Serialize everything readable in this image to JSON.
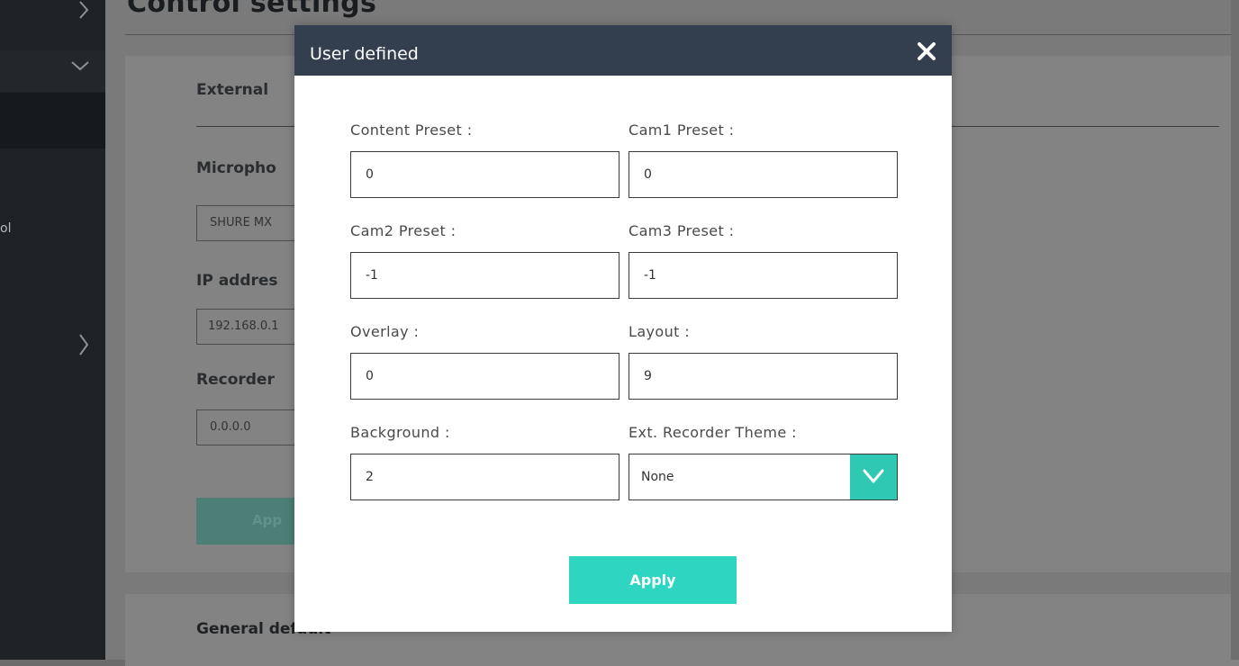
{
  "background": {
    "page_title": "Control settings",
    "sidebar_partial_text": "ol",
    "section_heading": "External",
    "microphone_label": "Micropho",
    "microphone_value": "SHURE MX",
    "ip_label": "IP addres",
    "ip_value": "192.168.0.1",
    "recorder_label": "Recorder",
    "recorder_value": "0.0.0.0",
    "apply_partial": "App",
    "general_heading": "General default"
  },
  "modal": {
    "title": "User defined",
    "fields": [
      {
        "label": "Content Preset :",
        "value": "0"
      },
      {
        "label": "Cam1 Preset :",
        "value": "0"
      },
      {
        "label": "Cam2 Preset :",
        "value": "-1"
      },
      {
        "label": "Cam3 Preset :",
        "value": "-1"
      },
      {
        "label": "Overlay :",
        "value": "0"
      },
      {
        "label": "Layout :",
        "value": "9"
      },
      {
        "label": "Background :",
        "value": "2"
      }
    ],
    "ext_recorder_theme": {
      "label": "Ext. Recorder Theme :",
      "value": "None"
    },
    "apply_label": "Apply"
  },
  "colors": {
    "modal_header": "#333f4e",
    "accent": "#2ed6c1",
    "select_button": "#2fc8b2"
  },
  "icons": [
    "close-icon",
    "chevron-down-icon",
    "chevron-right-icon"
  ]
}
